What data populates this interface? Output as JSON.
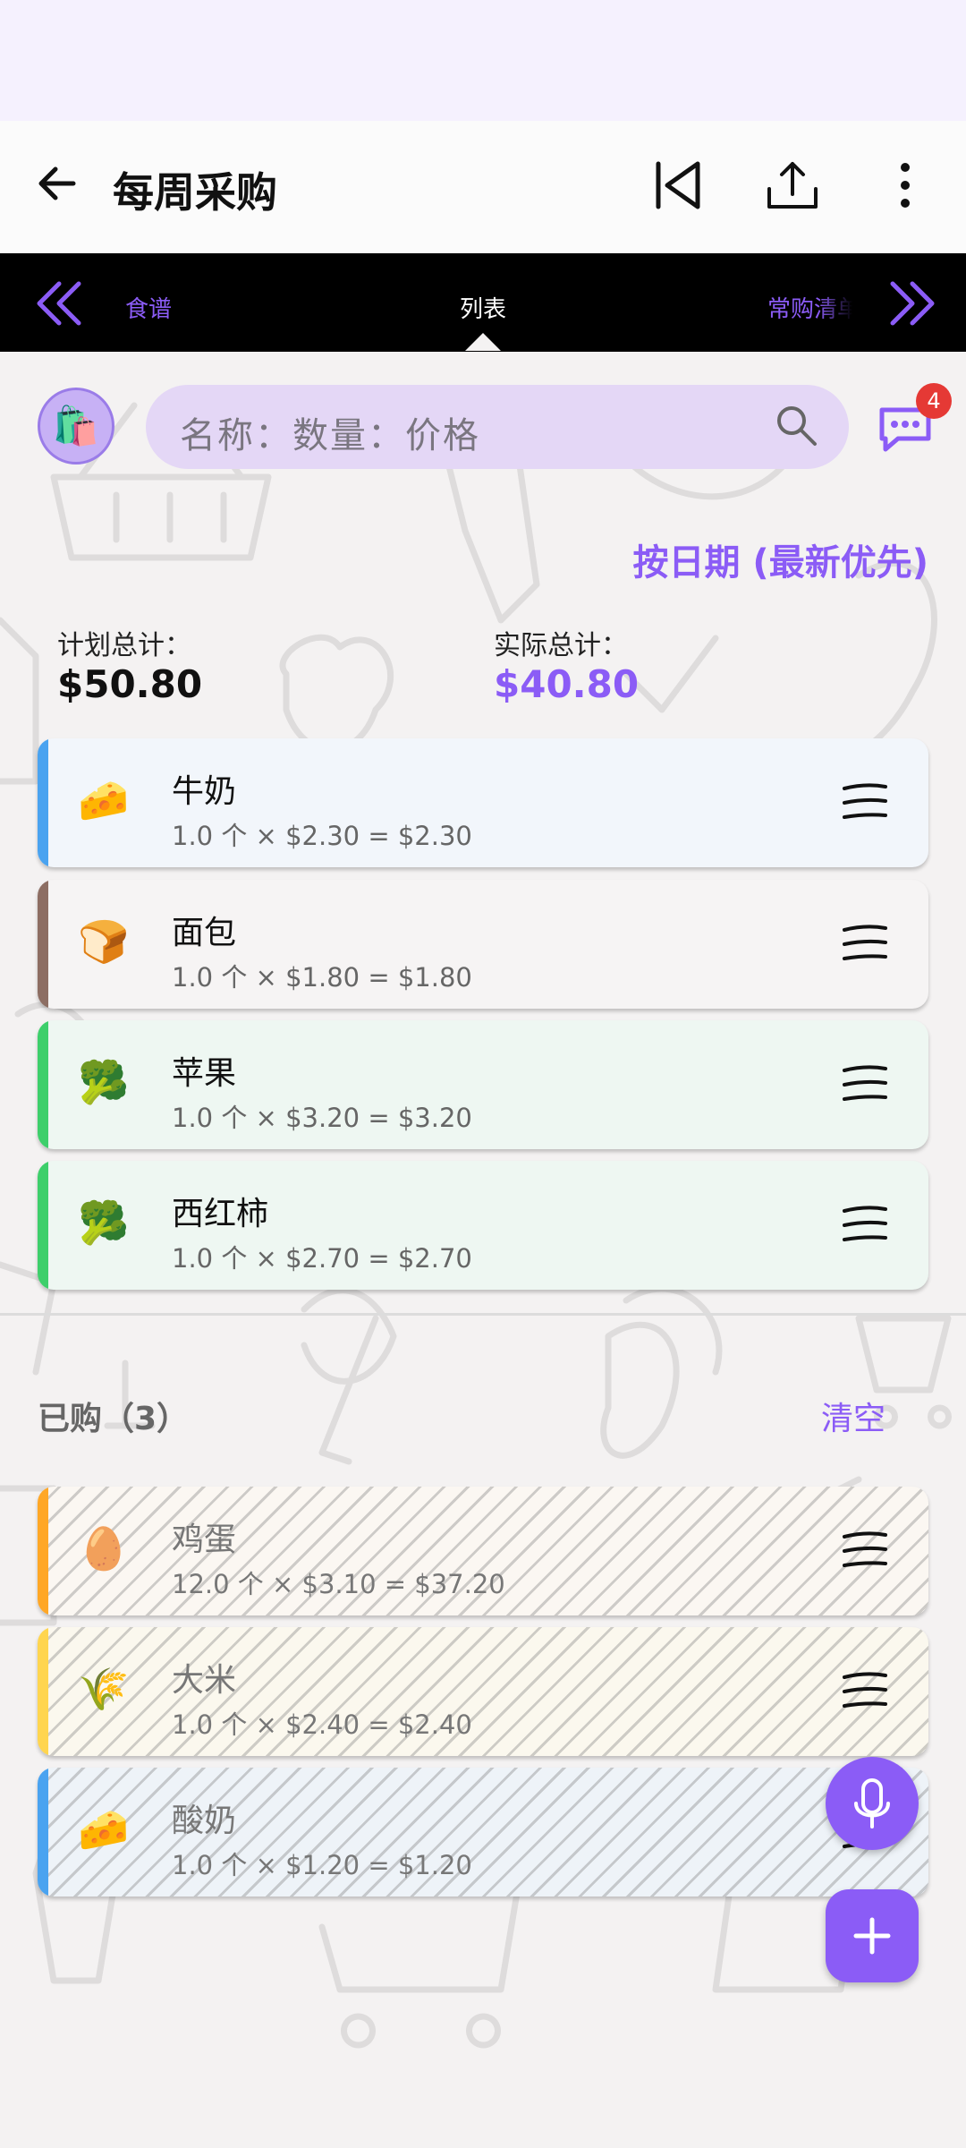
{
  "appbar": {
    "title": "每周采购"
  },
  "tabs": {
    "left": "食谱",
    "center": "列表",
    "right": "常购清单"
  },
  "search": {
    "placeholder": "名称：数量：价格"
  },
  "notifications": {
    "count": "4"
  },
  "sort_label": "按日期 (最新优先)",
  "totals": {
    "planned_label": "计划总计：",
    "planned_value": "$50.80",
    "actual_label": "实际总计：",
    "actual_value": "$40.80"
  },
  "colors": {
    "accent": "#8b5cf6"
  },
  "items": [
    {
      "emoji": "🧀",
      "name": "牛奶",
      "detail": "1.0 个 × $2.30 = $2.30",
      "bar": "#4aa3f0",
      "bg": "#f2f6fb"
    },
    {
      "emoji": "🍞",
      "name": "面包",
      "detail": "1.0 个 × $1.80 = $1.80",
      "bar": "#8d6e63",
      "bg": "#f6f4f4"
    },
    {
      "emoji": "🥦",
      "name": "苹果",
      "detail": "1.0 个 × $3.20 = $3.20",
      "bar": "#3ecf6b",
      "bg": "#eef7f2"
    },
    {
      "emoji": "🥦",
      "name": "西红柿",
      "detail": "1.0 个 × $2.70 = $2.70",
      "bar": "#3ecf6b",
      "bg": "#eef7f2"
    }
  ],
  "bought": {
    "header": "已购（3）",
    "clear_label": "清空",
    "items": [
      {
        "emoji": "🥚",
        "name": "鸡蛋",
        "detail": "12.0 个 × $3.10 = $37.20",
        "bar": "#ffa726",
        "bg": "#fbf7f2"
      },
      {
        "emoji": "🌾",
        "name": "大米",
        "detail": "1.0 个 × $2.40 = $2.40",
        "bar": "#ffd54f",
        "bg": "#fbf8ee"
      },
      {
        "emoji": "🧀",
        "name": "酸奶",
        "detail": "1.0 个 × $1.20 = $1.20",
        "bar": "#4aa3f0",
        "bg": "#eef3f8"
      }
    ]
  }
}
